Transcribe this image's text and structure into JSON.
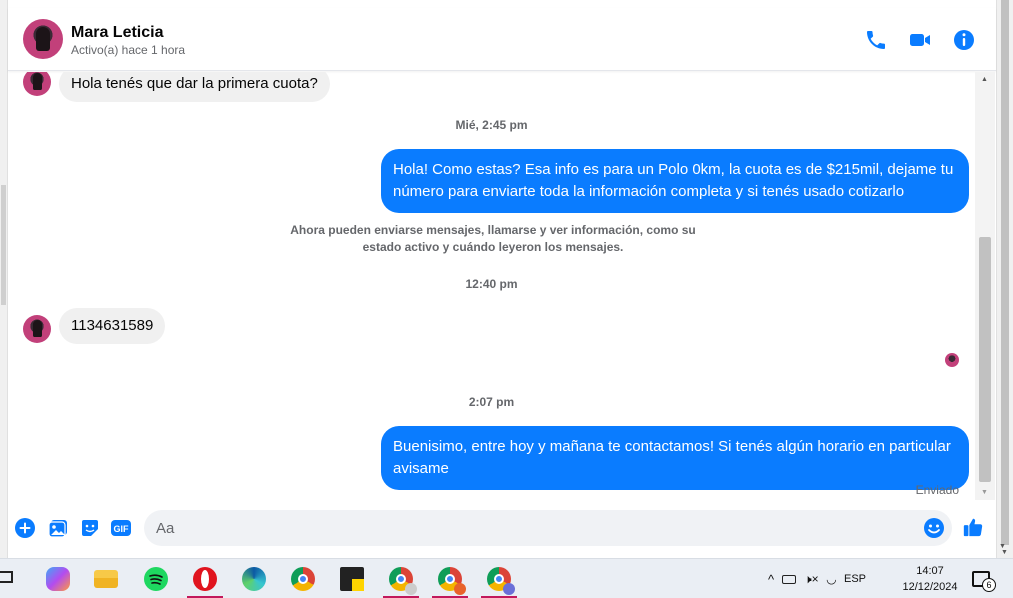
{
  "conversation": {
    "contact_name": "Mara Leticia",
    "status": "Activo(a) hace 1 hora"
  },
  "header_actions": {
    "call_icon": "phone-icon",
    "video_icon": "video-camera-icon",
    "info_icon": "info-icon",
    "accent_color": "#0a7cff"
  },
  "messages": [
    {
      "type": "incoming",
      "text": "Hola tenés que dar la primera cuota?"
    },
    {
      "type": "timestamp",
      "text": "Mié, 2:45 pm"
    },
    {
      "type": "outgoing",
      "text": "Hola! Como estas? Esa info es para un Polo 0km, la cuota es de $215mil, dejame tu número para enviarte toda la información completa y si tenés usado cotizarlo"
    },
    {
      "type": "system",
      "text": "Ahora pueden enviarse mensajes, llamarse y ver información, como su estado activo y cuándo leyeron los mensajes."
    },
    {
      "type": "timestamp",
      "text": "12:40 pm"
    },
    {
      "type": "incoming",
      "text": "1134631589"
    },
    {
      "type": "timestamp",
      "text": "2:07 pm"
    },
    {
      "type": "outgoing",
      "text": "Buenisimo, entre hoy y mañana te contactamos! Si tenés algún horario en particular avisame"
    }
  ],
  "delivery_status": "Enviado",
  "composer": {
    "placeholder": "Aa",
    "icons": [
      "plus-icon",
      "photo-icon",
      "sticker-icon",
      "gif-icon",
      "emoji-icon",
      "thumbs-up-icon"
    ],
    "gif_label": "GIF"
  },
  "taskbar": {
    "apps": [
      "task-view-icon",
      "copilot-icon",
      "file-explorer-icon",
      "spotify-icon",
      "opera-icon",
      "edge-icon",
      "chrome-icon",
      "sticky-notes-icon",
      "chrome-profile-y-icon",
      "chrome-profile-r-icon",
      "chrome-profile-c-icon"
    ],
    "language": "ESP",
    "time": "14:07",
    "date": "12/12/2024",
    "notification_count": "6"
  }
}
